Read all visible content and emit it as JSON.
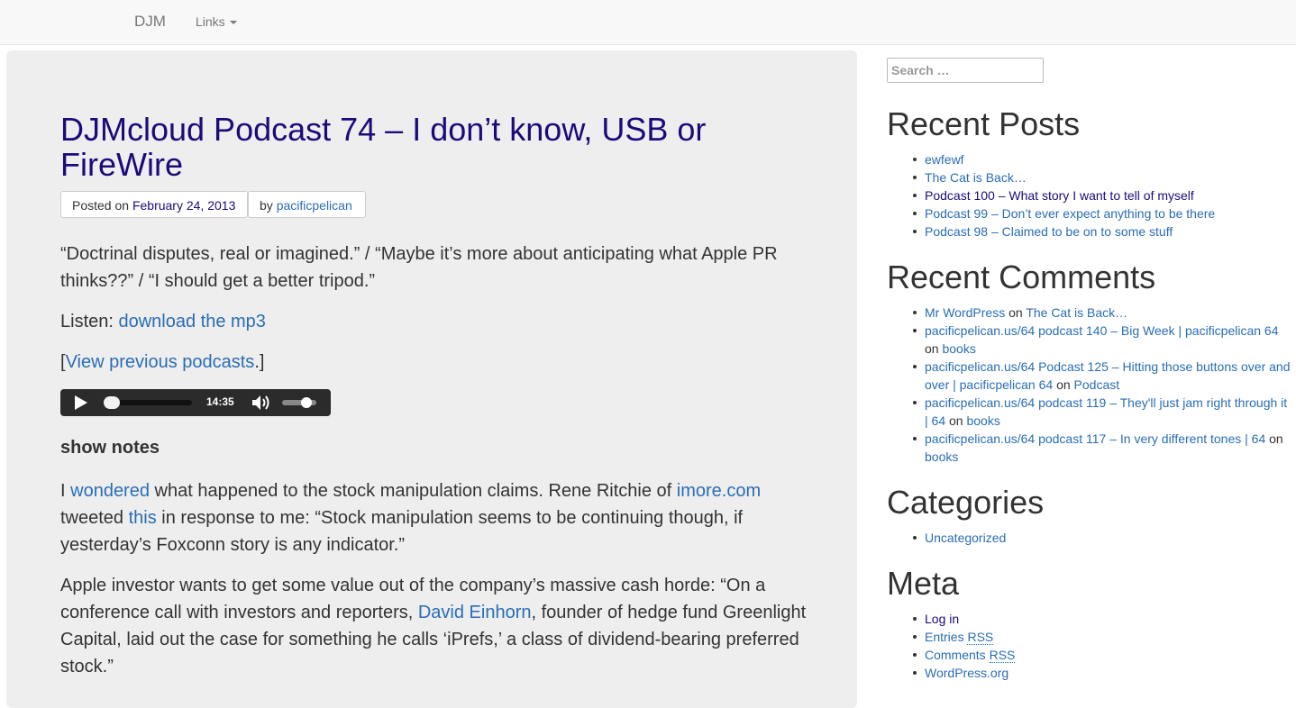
{
  "navbar": {
    "brand": "DJM",
    "links_label": "Links"
  },
  "post": {
    "title": "DJMcloud Podcast 74 – I don’t know, USB or FireWire",
    "posted_prefix": "Posted on",
    "posted_date": "February 24, 2013",
    "by_prefix": "by",
    "author": "pacificpelican",
    "intro": "“Doctrinal disputes, real or imagined.” / “Maybe it’s more about anticipating what Apple PR thinks??” / “I should get a better tripod.”",
    "listen_prefix": "Listen: ",
    "listen_link": "download the mp3",
    "view_open": "[",
    "view_link": "View previous podcasts",
    "view_close": ".]",
    "player": {
      "time": "14:35",
      "progress": 0.0,
      "volume": 0.8
    },
    "show_notes_heading": "show notes",
    "para1": {
      "t1": "I ",
      "l1": "wondered",
      "t2": " what happened to the stock manipulation claims. Rene Ritchie of ",
      "l2": "imore.com",
      "t3": " tweeted ",
      "l3": "this",
      "t4": " in response to me: “Stock manipulation seems to be continuing though, if yesterday’s Foxconn story is any indicator.”"
    },
    "para2": {
      "t1": "Apple investor wants to get some value out of the company’s massive cash horde: “On a conference call with investors and reporters, ",
      "l1": "David Einhorn",
      "t2": ", founder of hedge fund Greenlight Capital, laid out the case for something he calls ‘iPrefs,’ a class of dividend-bearing preferred stock.”"
    }
  },
  "sidebar": {
    "search_placeholder": "Search …",
    "recent_posts": {
      "title": "Recent Posts",
      "items": [
        "ewfewf",
        "The Cat is Back…",
        "Podcast 100 – What story I want to tell of myself",
        "Podcast 99 – Don’t ever expect anything to be there",
        "Podcast 98 – Claimed to be on to some stuff"
      ]
    },
    "recent_comments": {
      "title": "Recent Comments",
      "on": "on",
      "items": [
        {
          "author": "Mr WordPress",
          "post": "The Cat is Back…"
        },
        {
          "author": "pacificpelican.us/64 podcast 140 – Big Week | pacificpelican 64",
          "post": "books"
        },
        {
          "author": "pacificpelican.us/64 Podcast 125 – Hitting those buttons over and over | pacificpelican 64",
          "post": "Podcast"
        },
        {
          "author": "pacificpelican.us/64 podcast 119 – They'll just jam right through it | 64",
          "post": "books"
        },
        {
          "author": "pacificpelican.us/64 podcast 117 – In very different tones | 64",
          "post": "books"
        }
      ]
    },
    "categories": {
      "title": "Categories",
      "items": [
        "Uncategorized"
      ]
    },
    "meta": {
      "title": "Meta",
      "log_in": "Log in",
      "entries": "Entries",
      "comments": "Comments",
      "rss": "RSS",
      "wordpress": "WordPress.org"
    }
  }
}
